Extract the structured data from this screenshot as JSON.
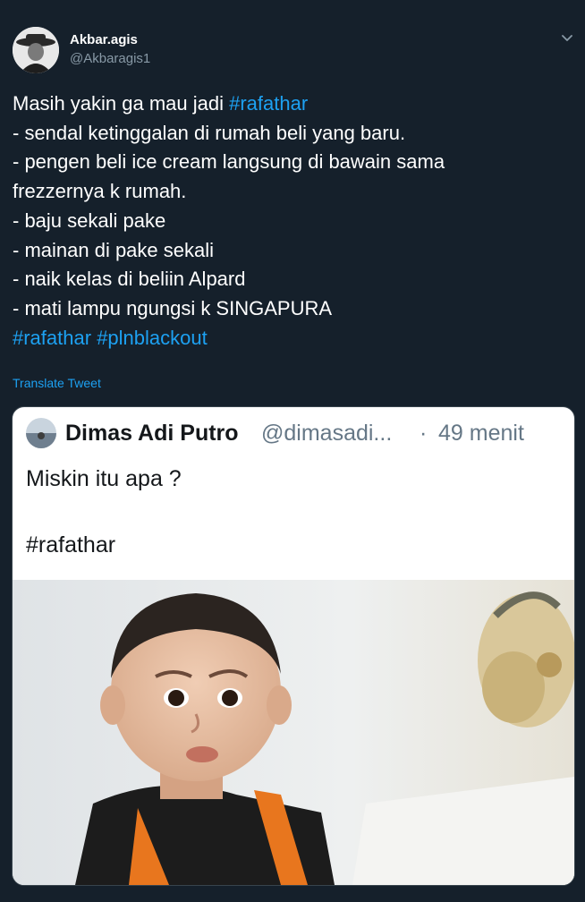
{
  "tweet": {
    "author": {
      "name": "Akbar.agis",
      "handle": "@Akbaragis1",
      "avatar_icon": "user-avatar"
    },
    "menu_icon": "chevron-down-icon",
    "text": {
      "line1_prefix": "Masih yakin ga mau jadi ",
      "line1_hashtag": "#rafathar",
      "line2": "- sendal ketinggalan di rumah beli yang baru.",
      "line3": "- pengen beli ice cream langsung di bawain sama",
      "line4": "frezzernya k rumah.",
      "line5": "- baju sekali pake",
      "line6": "- mainan di pake sekali",
      "line7": "- naik kelas di beliin Alpard",
      "line8": "- mati lampu ngungsi k SINGAPURA",
      "hashtag_a": "#rafathar",
      "hashtag_b": "#plnblackout"
    },
    "translate_label": "Translate Tweet",
    "colors": {
      "background": "#15202b",
      "link": "#1da1f2",
      "secondary_text": "#8899a6"
    }
  },
  "embedded_screenshot": {
    "author_name": "Dimas Adi Putro",
    "author_handle": "@dimasadi...",
    "separator": "·",
    "time": "49 menit",
    "text": "Miskin itu apa ?",
    "hashtag": "#rafathar",
    "photo_subject": "child-portrait"
  }
}
